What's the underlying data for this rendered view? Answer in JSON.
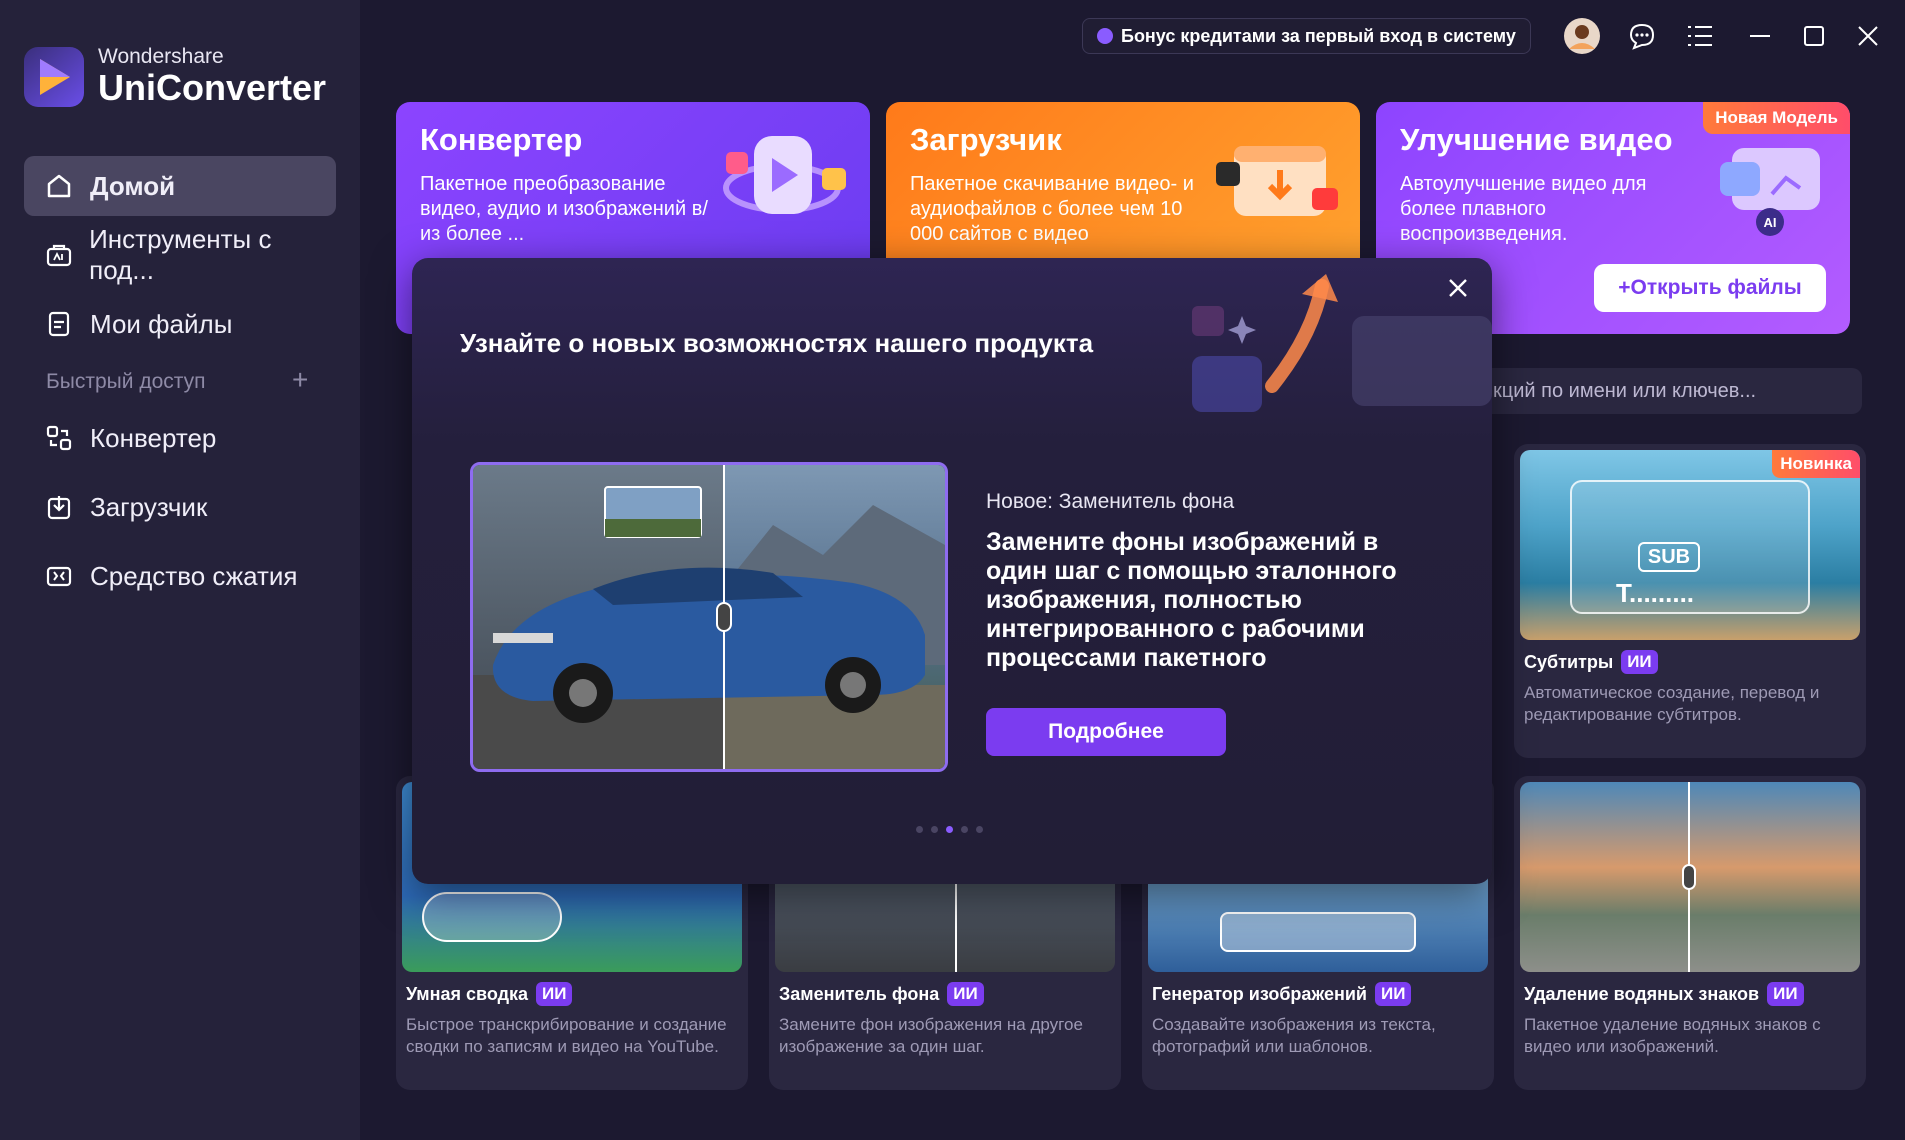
{
  "app": {
    "brand_small": "Wondershare",
    "brand_big": "UniConverter"
  },
  "sidebar": {
    "items": [
      {
        "label": "Домой",
        "icon": "home-icon"
      },
      {
        "label": "Инструменты с под...",
        "icon": "ai-tools-icon"
      },
      {
        "label": "Мои файлы",
        "icon": "files-icon"
      }
    ],
    "quick_access_label": "Быстрый доступ",
    "quick_items": [
      {
        "label": "Конвертер",
        "icon": "converter-icon"
      },
      {
        "label": "Загрузчик",
        "icon": "download-icon"
      },
      {
        "label": "Средство сжатия",
        "icon": "compress-icon"
      }
    ]
  },
  "topbar": {
    "bonus": "Бонус кредитами за первый вход в систему"
  },
  "cards": {
    "converter": {
      "title": "Конвертер",
      "desc": "Пакетное преобразование видео, аудио и изображений в/из более ..."
    },
    "downloader": {
      "title": "Загрузчик",
      "desc": "Пакетное скачивание видео- и аудиофайлов с более чем 10 000 сайтов с видео"
    },
    "enhance": {
      "title": "Улучшение видео",
      "desc": "Автоулучшение видео для более плавного воспроизведения.",
      "badge": "Новая Модель",
      "button": "+Открыть файлы"
    }
  },
  "search": {
    "placeholder": "ункций по имени или ключев..."
  },
  "tools": [
    {
      "title": "Субтитры",
      "ai": "ИИ",
      "badge": "Новинка",
      "desc": "Автоматическое создание, перевод и редактирование субтитров."
    },
    {
      "title": "Умная сводка",
      "ai": "ИИ",
      "desc": "Быстрое транскрибирование и создание сводки по записям и видео на YouTube."
    },
    {
      "title": "Заменитель фона",
      "ai": "ИИ",
      "desc": "Замените фон изображения на другое изображение за один шаг."
    },
    {
      "title": "Генератор изображений",
      "ai": "ИИ",
      "desc": "Создавайте изображения из текста, фотографий или шаблонов."
    },
    {
      "title": "Удаление водяных знаков",
      "ai": "ИИ",
      "desc": "Пакетное удаление водяных знаков с видео или изображений."
    }
  ],
  "modal": {
    "title": "Узнайте о новых возможностях нашего продукта",
    "new_label": "Новое: Заменитель фона",
    "text": "Замените фоны изображений в один шаг с помощью эталонного изображения, полностью интегрированного с рабочими процессами пакетного",
    "button": "Подробнее",
    "dots_total": 5,
    "dots_active": 3
  }
}
